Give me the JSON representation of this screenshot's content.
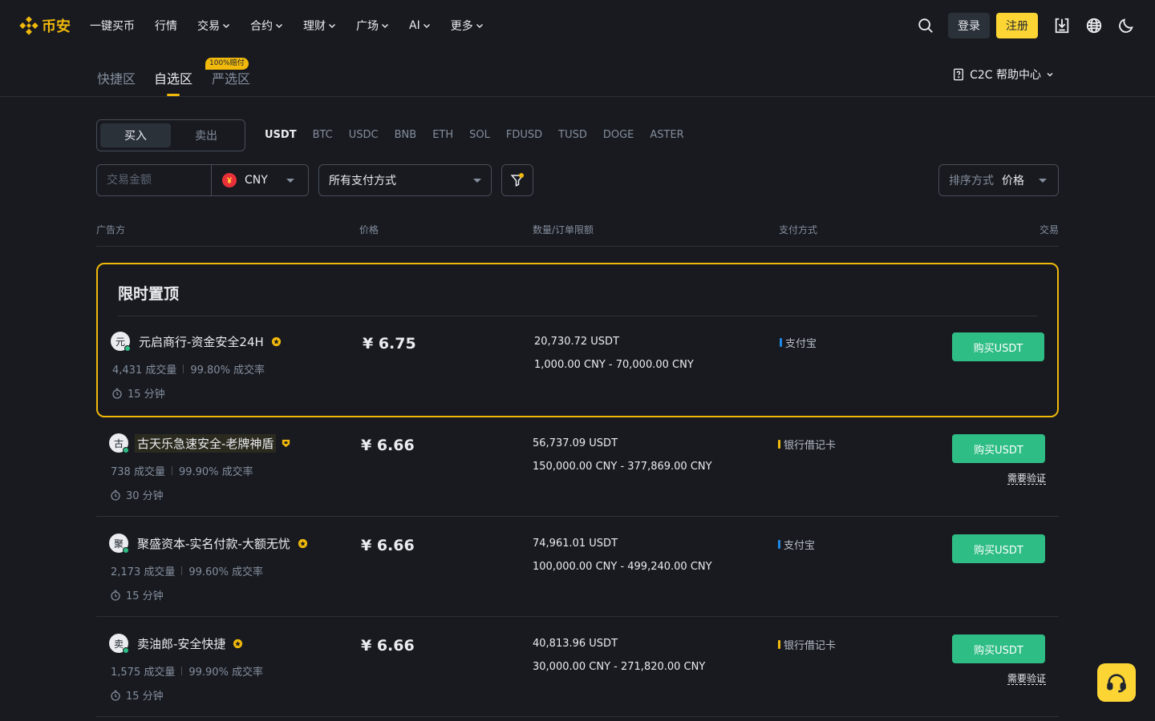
{
  "brand": {
    "logo_text": "币安",
    "accent": "#f0b90b"
  },
  "nav": {
    "items": [
      {
        "label": "一键买币",
        "dropdown": false
      },
      {
        "label": "行情",
        "dropdown": false
      },
      {
        "label": "交易",
        "dropdown": true
      },
      {
        "label": "合约",
        "dropdown": true
      },
      {
        "label": "理财",
        "dropdown": true
      },
      {
        "label": "广场",
        "dropdown": true
      },
      {
        "label": "AI",
        "dropdown": true
      },
      {
        "label": "更多",
        "dropdown": true
      }
    ],
    "login_label": "登录",
    "register_label": "注册"
  },
  "subnav": {
    "tabs": [
      "快捷区",
      "自选区",
      "严选区"
    ],
    "active_tab": "自选区",
    "badge": "100%赔付",
    "help_center": "C2C 帮助中心"
  },
  "filters": {
    "buy_label": "买入",
    "sell_label": "卖出",
    "coins": [
      "USDT",
      "BTC",
      "USDC",
      "BNB",
      "ETH",
      "SOL",
      "FDUSD",
      "TUSD",
      "DOGE",
      "ASTER"
    ],
    "active_coin": "USDT",
    "amount_placeholder": "交易金额",
    "currency": "CNY",
    "payment_method": "所有支付方式",
    "sort_label": "排序方式",
    "sort_value": "价格"
  },
  "table": {
    "headers": [
      "广告方",
      "价格",
      "数量/订单限额",
      "支付方式",
      "交易"
    ]
  },
  "featured": {
    "title": "限时置顶"
  },
  "ads": [
    {
      "avatar": "元",
      "name": "元启商行-资金安全24H",
      "highlight": false,
      "trades": "4,431 成交量",
      "rate": "99.80% 成交率",
      "time": "15 分钟",
      "price": "¥ 6.75",
      "qty": "20,730.72 USDT",
      "limit": "1,000.00 CNY - 70,000.00 CNY",
      "pay": "支付宝",
      "pay_color": "#1e88e5",
      "badge_color": "#f0b90b",
      "buy_label": "购买USDT",
      "verify": ""
    },
    {
      "avatar": "古",
      "name": "古天乐急速安全-老牌神盾",
      "highlight": true,
      "trades": "738 成交量",
      "rate": "99.90% 成交率",
      "time": "30 分钟",
      "price": "¥ 6.66",
      "qty": "56,737.09 USDT",
      "limit": "150,000.00 CNY - 377,869.00 CNY",
      "pay": "银行借记卡",
      "pay_color": "#f0b90b",
      "badge_color": "#f0b90b",
      "buy_label": "购买USDT",
      "verify": "需要验证"
    },
    {
      "avatar": "聚",
      "name": "聚盛资本-实名付款-大额无忧",
      "highlight": false,
      "trades": "2,173 成交量",
      "rate": "99.60% 成交率",
      "time": "15 分钟",
      "price": "¥ 6.66",
      "qty": "74,961.01 USDT",
      "limit": "100,000.00 CNY - 499,240.00 CNY",
      "pay": "支付宝",
      "pay_color": "#1e88e5",
      "badge_color": "#f0b90b",
      "buy_label": "购买USDT",
      "verify": ""
    },
    {
      "avatar": "卖",
      "name": "卖油郎-安全快捷",
      "highlight": false,
      "trades": "1,575 成交量",
      "rate": "99.90% 成交率",
      "time": "15 分钟",
      "price": "¥ 6.66",
      "qty": "40,813.96 USDT",
      "limit": "30,000.00 CNY - 271,820.00 CNY",
      "pay": "银行借记卡",
      "pay_color": "#f0b90b",
      "badge_color": "#f0b90b",
      "buy_label": "购买USDT",
      "verify": "需要验证"
    }
  ]
}
